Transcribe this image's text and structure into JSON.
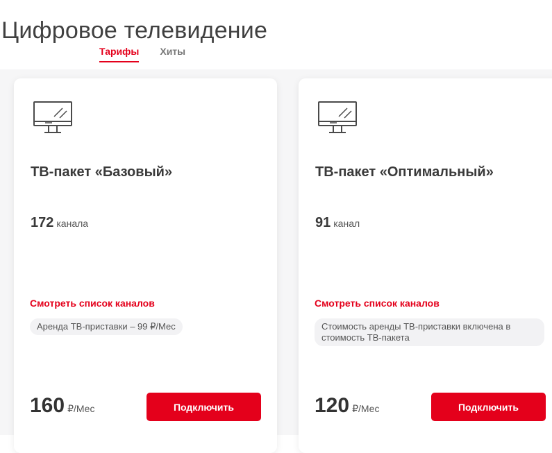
{
  "page": {
    "title": "Цифровое телевидение"
  },
  "tabs": [
    {
      "label": "Тарифы",
      "active": true
    },
    {
      "label": "Хиты",
      "active": false
    }
  ],
  "colors": {
    "accent": "#e4001b",
    "text": "#333333",
    "note_bg": "#f2f2f4"
  },
  "cards": [
    {
      "icon": "tv-monitor-icon",
      "title": "ТВ-пакет «Базовый»",
      "channels_count": "172",
      "channels_unit": "канала",
      "channels_link": "Смотреть список каналов",
      "note": "Аренда ТВ-приставки – 99 ₽/Мес",
      "price": "160",
      "price_unit": "₽/Мес",
      "button_label": "Подключить"
    },
    {
      "icon": "tv-monitor-icon",
      "title": "ТВ-пакет «Оптимальный»",
      "channels_count": "91",
      "channels_unit": "канал",
      "channels_link": "Смотреть список каналов",
      "note": "Стоимость аренды ТВ-приставки включена в стоимость ТВ-пакета",
      "price": "120",
      "price_unit": "₽/Мес",
      "button_label": "Подключить"
    }
  ]
}
